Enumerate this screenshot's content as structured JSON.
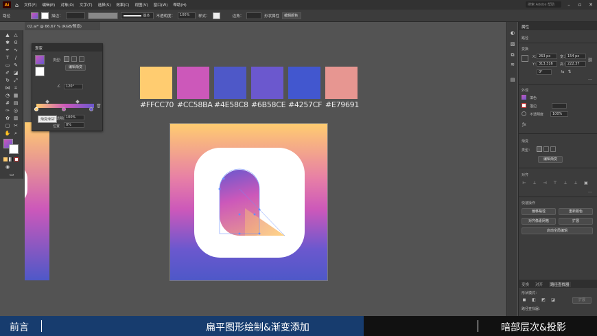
{
  "menubar": {
    "logo": "Ai",
    "items": [
      "文件(F)",
      "编辑(E)",
      "对象(O)",
      "文字(T)",
      "选择(S)",
      "效果(C)",
      "视图(V)",
      "窗口(W)",
      "帮助(H)"
    ],
    "search_placeholder": "搜索 Adobe 帮助"
  },
  "controlbar": {
    "selection_label": "路径",
    "stroke_label": "描边：",
    "stroke_style": "基本",
    "opacity_label": "不透明度：",
    "opacity_value": "100%",
    "style_label": "样式：",
    "corner_label": "边角：",
    "shape_label": "形状属性",
    "recolor_button": "编辑颜色"
  },
  "doctab": {
    "title": "02.ai* @ 66.67 % (RGB/预览)"
  },
  "swatches": [
    {
      "hex": "#FFCC70",
      "label": "#FFCC70"
    },
    {
      "hex": "#CC58BA",
      "label": "#CC58BA"
    },
    {
      "hex": "#4E58C8",
      "label": "#4E58C8"
    },
    {
      "hex": "#6B58CE",
      "label": "#6B58CE"
    },
    {
      "hex": "#4257CF",
      "label": "#4257CF"
    },
    {
      "hex": "#E79691",
      "label": "#E79691"
    }
  ],
  "gradient_panel": {
    "title": "渐变",
    "type_label": "类型：",
    "edit_button": "编辑渐变",
    "angle_value": "120°",
    "tooltip": "渐变滑块",
    "opacity_label": "不透明度",
    "opacity_value": "100%",
    "location_label": "位置",
    "location_value": "0%"
  },
  "properties_panel": {
    "tabs": [
      "属性"
    ],
    "selection": "路径",
    "transform_title": "变换",
    "x_label": "X：",
    "x_value": "263 px",
    "y_label": "Y：",
    "y_value": "313.316",
    "w_label": "宽：",
    "w_value": "154 px",
    "h_label": "高：",
    "h_value": "222.37",
    "rotate_value": "0°",
    "appearance_title": "外观",
    "fill_label": "填色",
    "stroke_label": "描边",
    "opacity_label": "不透明度",
    "opacity_value": "100%",
    "gradient_title": "渐变",
    "gradient_type_label": "类型：",
    "gradient_edit_button": "编辑渐变",
    "align_title": "对齐",
    "quick_actions_title": "快速操作",
    "btn_offset_path": "偏移路径",
    "btn_recolor": "重新着色",
    "btn_pixel_grid": "对齐像素网格",
    "btn_expand": "扩展",
    "btn_global_edit": "启动全局编辑",
    "bottom_tabs": [
      "变换",
      "对齐",
      "路径查找器"
    ],
    "shape_modes_label": "形状模式：",
    "pathfinder_label": "路径查找器：",
    "expand_label": "扩展"
  },
  "chapterbar": {
    "left": "前言",
    "middle": "扁平图形绘制&渐变添加",
    "right": "暗部层次&投影"
  }
}
